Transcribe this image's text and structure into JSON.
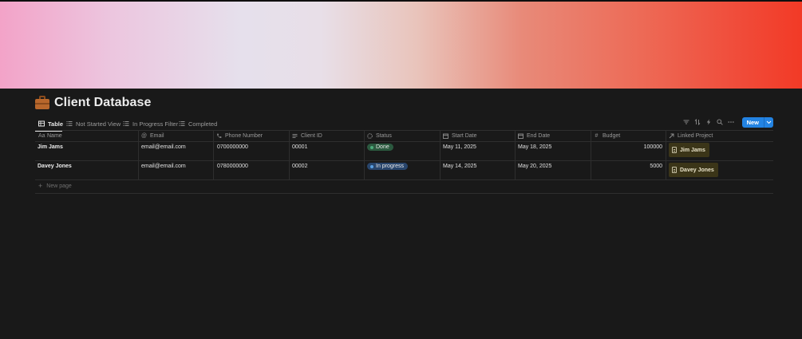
{
  "page": {
    "title": "Client Database",
    "icon": "briefcase-icon",
    "cover_colors": [
      "#f3a3c8",
      "#e6e0ec",
      "#e88a79",
      "#f23a26"
    ]
  },
  "views": [
    {
      "label": "Table",
      "icon": "table-icon",
      "active": true
    },
    {
      "label": "Not Started View",
      "icon": "list-icon",
      "active": false
    },
    {
      "label": "In Progress Filter",
      "icon": "list-icon",
      "active": false
    },
    {
      "label": "Completed",
      "icon": "list-icon",
      "active": false
    }
  ],
  "toolbar": {
    "icons": [
      "filter-icon",
      "sort-icon",
      "automation-icon",
      "search-icon",
      "more-icon"
    ],
    "new_label": "New",
    "accent": "#2383e2"
  },
  "columns": [
    {
      "label": "Name",
      "icon": "title-property-icon"
    },
    {
      "label": "Email",
      "icon": "at-icon"
    },
    {
      "label": "Phone Number",
      "icon": "phone-icon"
    },
    {
      "label": "Client ID",
      "icon": "text-property-icon"
    },
    {
      "label": "Status",
      "icon": "status-icon"
    },
    {
      "label": "Start Date",
      "icon": "calendar-icon"
    },
    {
      "label": "End Date",
      "icon": "calendar-icon"
    },
    {
      "label": "Budget",
      "icon": "number-icon"
    },
    {
      "label": "Linked Project",
      "icon": "relation-arrow-icon"
    }
  ],
  "rows": [
    {
      "name": "Jim Jams",
      "email": "email@email.com",
      "phone": "0700000000",
      "client_id": "00001",
      "status": "Done",
      "status_color": "#2b593f",
      "start_date": "May 11, 2025",
      "end_date": "May 18, 2025",
      "budget": "100000",
      "linked_project": "Jim Jams"
    },
    {
      "name": "Davey Jones",
      "email": "email@email.com",
      "phone": "0780000000",
      "client_id": "00002",
      "status": "In progress",
      "status_color": "#28456c",
      "start_date": "May 14, 2025",
      "end_date": "May 20, 2025",
      "budget": "5000",
      "linked_project": "Davey Jones"
    }
  ],
  "new_page_label": "New page"
}
